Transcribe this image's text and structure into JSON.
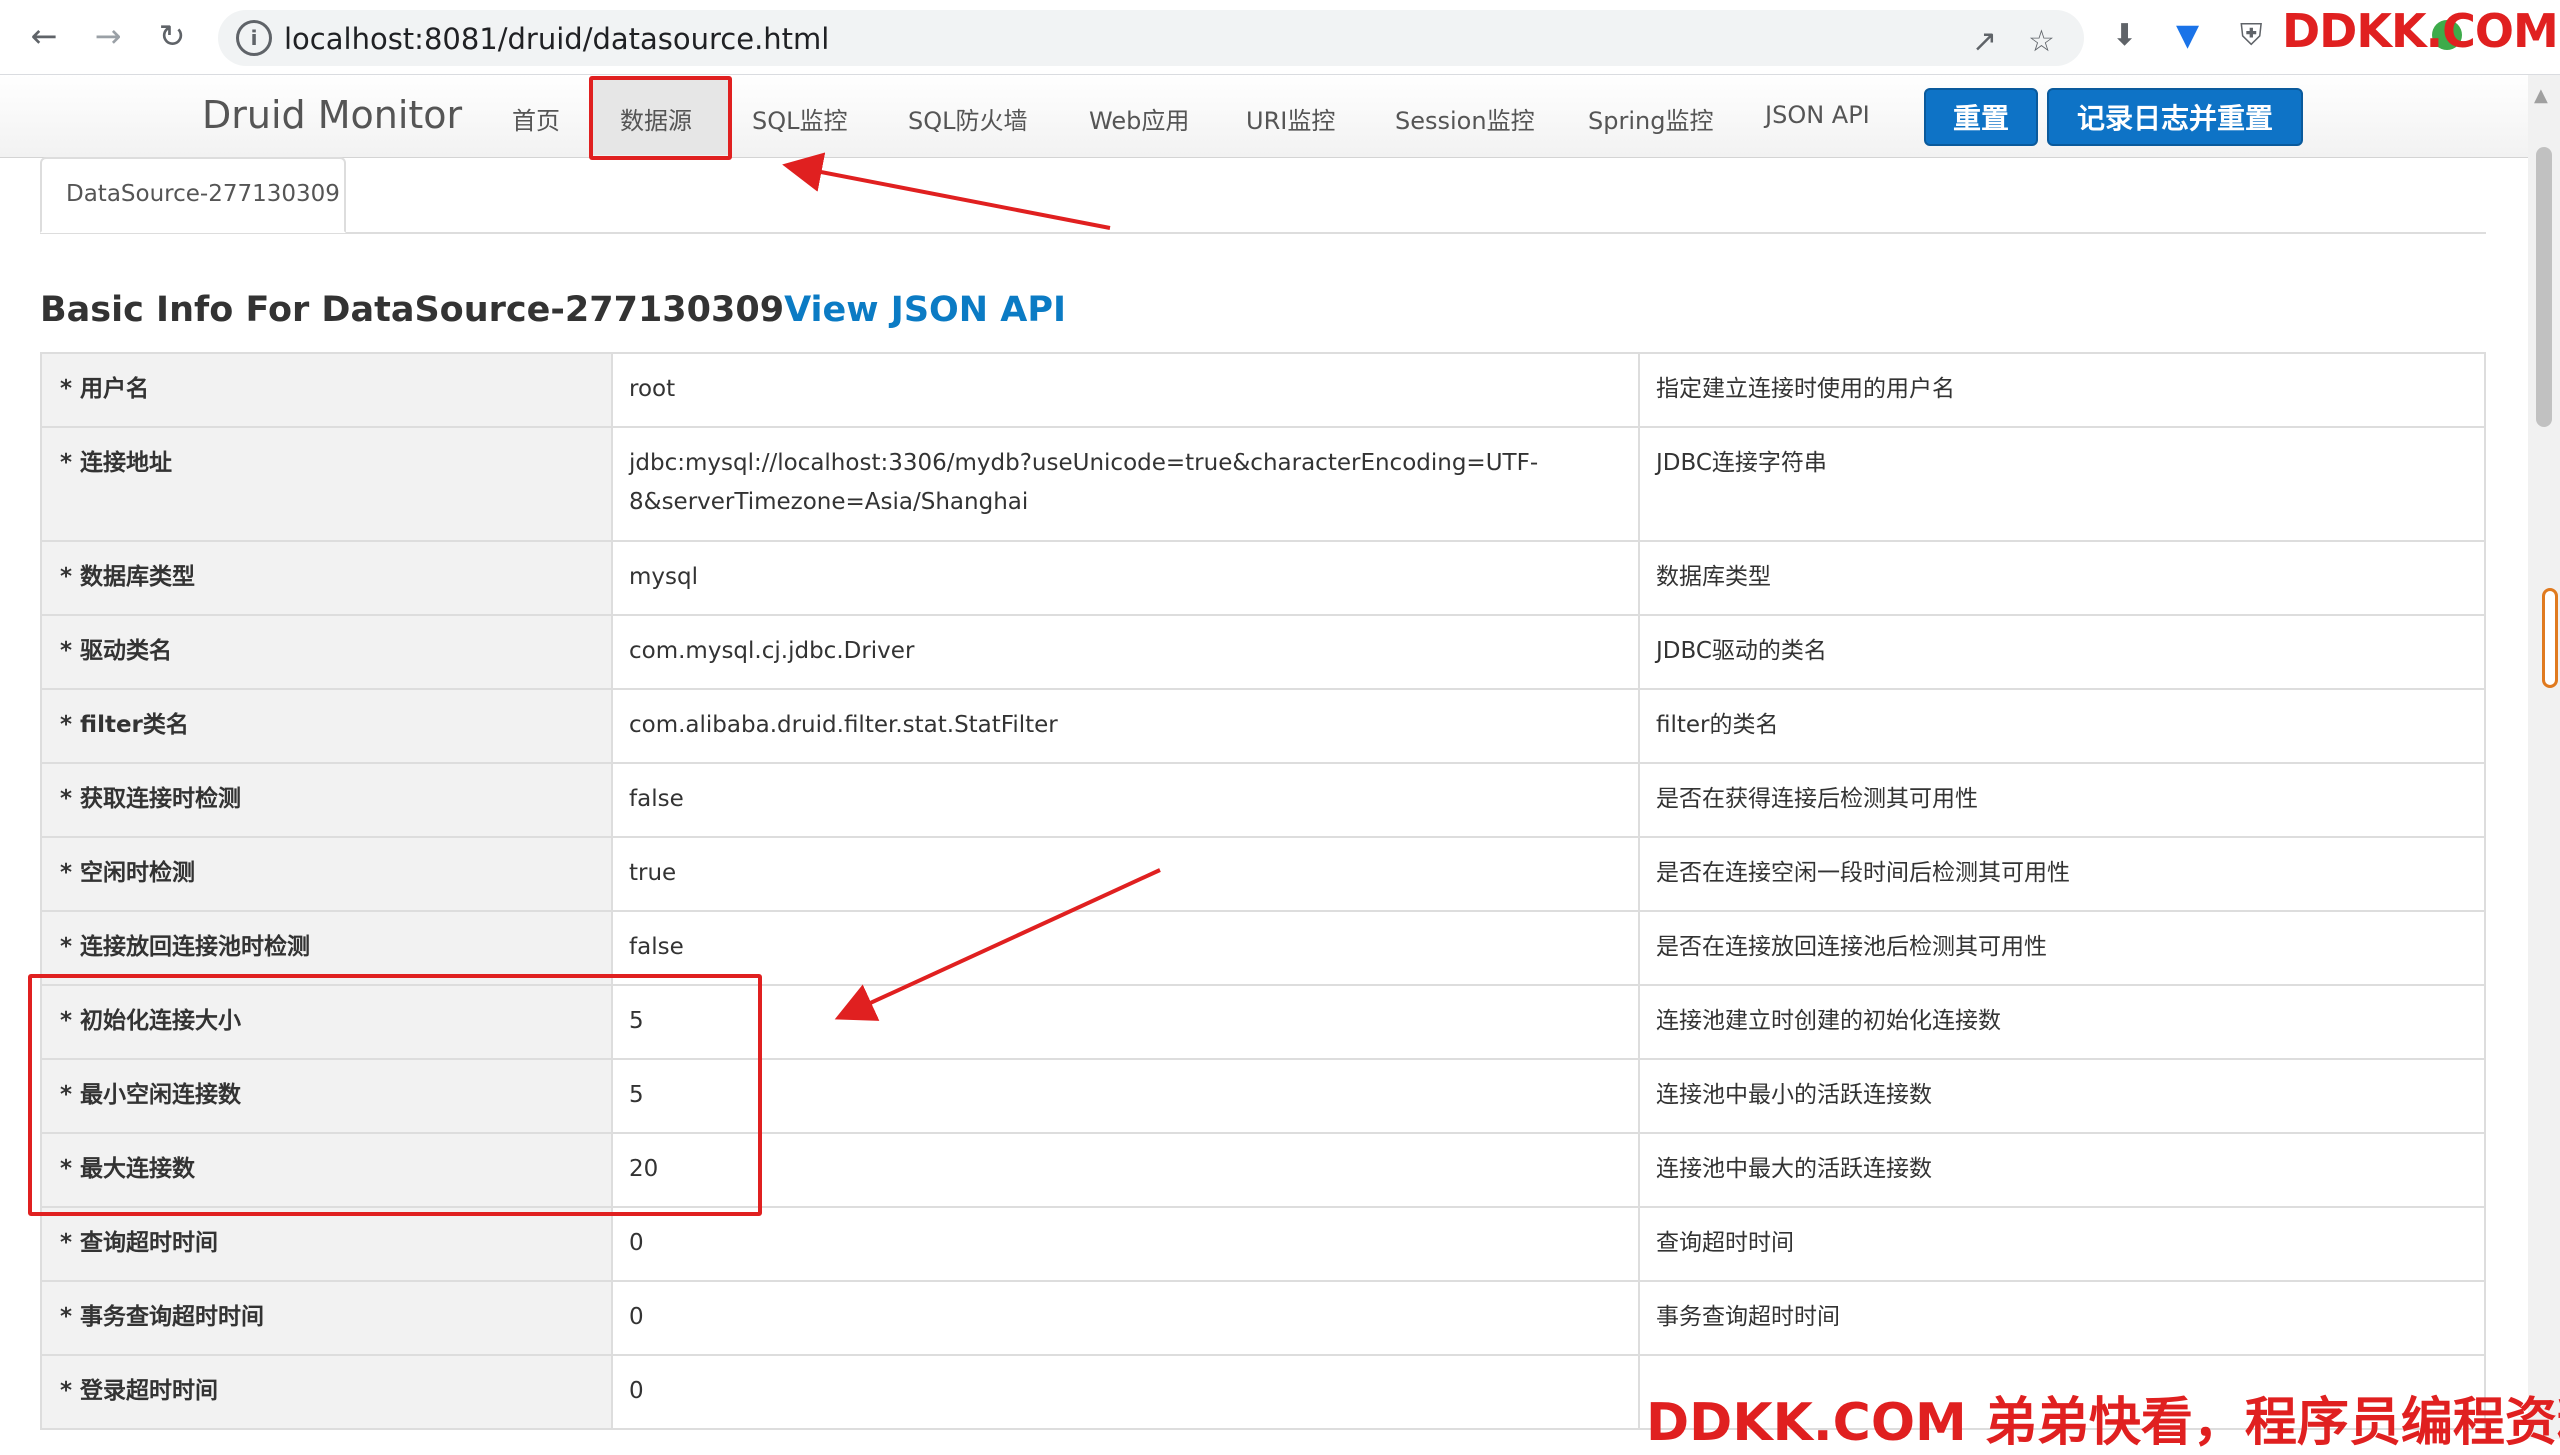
{
  "browser": {
    "url": "localhost:8081/druid/datasource.html",
    "logo_text": "DDKK.COM"
  },
  "druid": {
    "brand": "Druid Monitor",
    "nav": [
      "首页",
      "数据源",
      "SQL监控",
      "SQL防火墙",
      "Web应用",
      "URI监控",
      "Session监控",
      "Spring监控",
      "JSON API"
    ],
    "active_nav": "数据源",
    "reset_button": "重置",
    "log_reset_button": "记录日志并重置"
  },
  "tab": {
    "label": "DataSource-277130309"
  },
  "heading": {
    "prefix": "Basic Info For DataSource-277130309",
    "link": "View JSON API"
  },
  "rows": [
    {
      "name": "* 用户名",
      "value": "root",
      "desc": "指定建立连接时使用的用户名"
    },
    {
      "name": "* 连接地址",
      "value": "jdbc:mysql://localhost:3306/mydb?useUnicode=true&characterEncoding=UTF-8&serverTimezone=Asia/Shanghai",
      "desc": "JDBC连接字符串"
    },
    {
      "name": "* 数据库类型",
      "value": "mysql",
      "desc": "数据库类型"
    },
    {
      "name": "* 驱动类名",
      "value": "com.mysql.cj.jdbc.Driver",
      "desc": "JDBC驱动的类名"
    },
    {
      "name": "* filter类名",
      "value": "com.alibaba.druid.filter.stat.StatFilter",
      "desc": "filter的类名"
    },
    {
      "name": "* 获取连接时检测",
      "value": "false",
      "desc": "是否在获得连接后检测其可用性"
    },
    {
      "name": "* 空闲时检测",
      "value": "true",
      "desc": "是否在连接空闲一段时间后检测其可用性"
    },
    {
      "name": "* 连接放回连接池时检测",
      "value": "false",
      "desc": "是否在连接放回连接池后检测其可用性"
    },
    {
      "name": "* 初始化连接大小",
      "value": "5",
      "desc": "连接池建立时创建的初始化连接数"
    },
    {
      "name": "* 最小空闲连接数",
      "value": "5",
      "desc": "连接池中最小的活跃连接数"
    },
    {
      "name": "* 最大连接数",
      "value": "20",
      "desc": "连接池中最大的活跃连接数"
    },
    {
      "name": "* 查询超时时间",
      "value": "0",
      "desc": "查询超时时间"
    },
    {
      "name": "* 事务查询超时时间",
      "value": "0",
      "desc": "事务查询超时时间"
    },
    {
      "name": "* 登录超时时间",
      "value": "0",
      "desc": ""
    }
  ],
  "watermark": "DDKK.COM 弟弟快看，程序员编程资料站",
  "colors": {
    "accent_button": "#0e73c6",
    "link": "#0b7bc4",
    "annotation_red": "#e02020"
  }
}
